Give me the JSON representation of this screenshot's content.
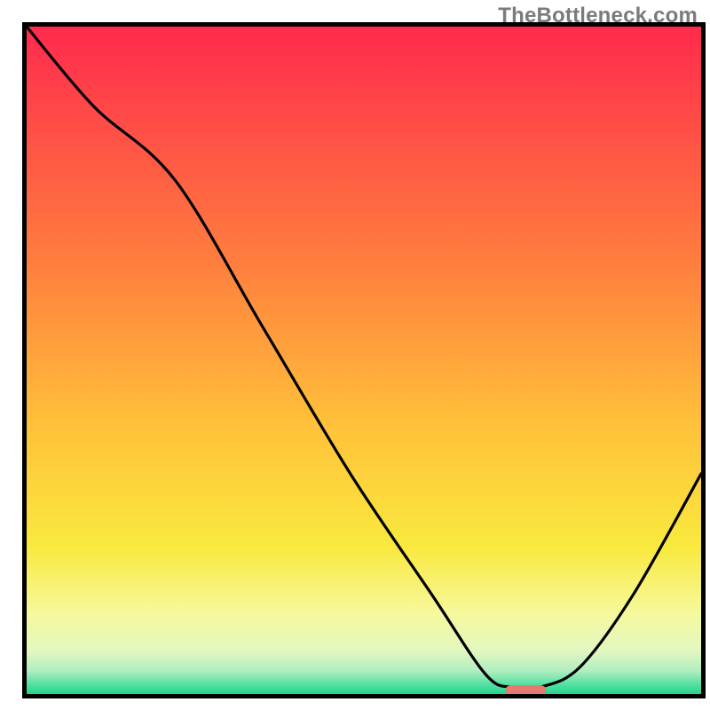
{
  "watermark": "TheBottleneck.com",
  "chart_data": {
    "type": "line",
    "title": "",
    "xlabel": "",
    "ylabel": "",
    "xlim": [
      0,
      100
    ],
    "ylim": [
      0,
      100
    ],
    "grid": false,
    "gradient_background": {
      "stops": [
        {
          "offset": 0.0,
          "color": "#ff2a4d"
        },
        {
          "offset": 0.35,
          "color": "#ff7d3e"
        },
        {
          "offset": 0.6,
          "color": "#ffc23a"
        },
        {
          "offset": 0.78,
          "color": "#f9e93e"
        },
        {
          "offset": 0.88,
          "color": "#f6f99d"
        },
        {
          "offset": 0.935,
          "color": "#e3f7c0"
        },
        {
          "offset": 0.965,
          "color": "#b1eec0"
        },
        {
          "offset": 0.985,
          "color": "#58e0a3"
        },
        {
          "offset": 1.0,
          "color": "#1fd68c"
        }
      ]
    },
    "series": [
      {
        "name": "bottleneck-curve",
        "color": "#000000",
        "x": [
          0,
          10,
          22,
          35,
          48,
          60,
          68,
          72,
          76,
          82,
          90,
          100
        ],
        "values": [
          100,
          88,
          77,
          55,
          33,
          15,
          3,
          1,
          1,
          4,
          15,
          33
        ]
      }
    ],
    "marker": {
      "name": "optimal-marker",
      "color": "#e4796f",
      "x": 74,
      "y": 0.6,
      "width": 6,
      "height": 1.4,
      "rx": 0.7
    },
    "frame": {
      "stroke": "#000000",
      "stroke_width": 5,
      "inset_top": 30,
      "inset_left": 30,
      "inset_right": 10,
      "inset_bottom": 18
    }
  }
}
